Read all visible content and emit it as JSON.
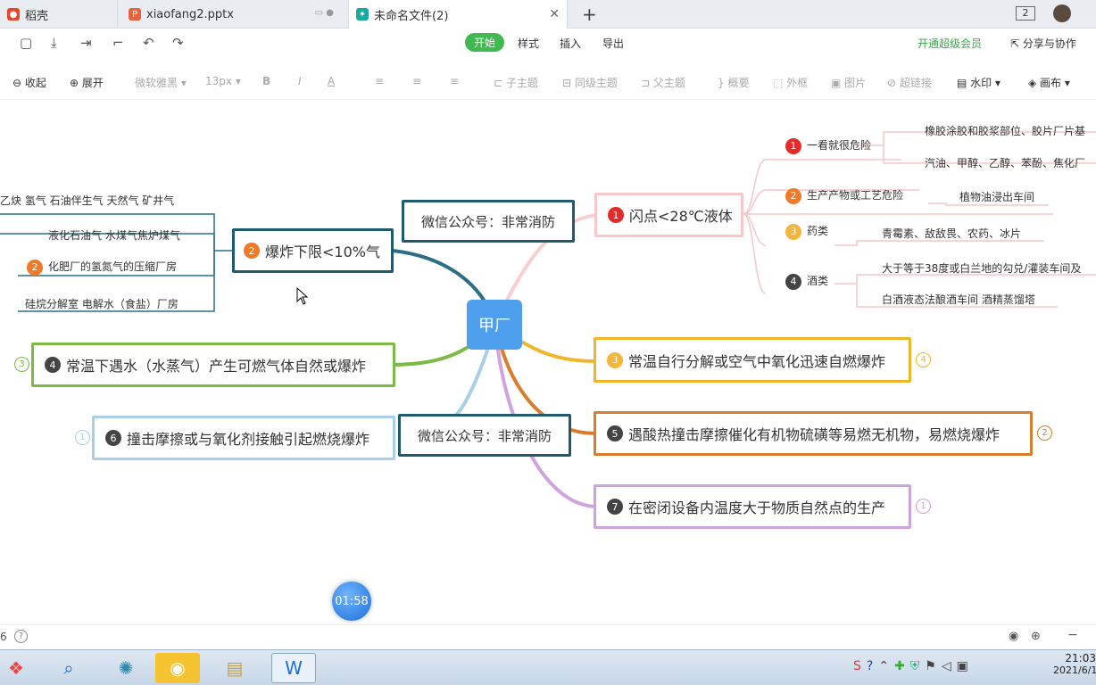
{
  "tabs": [
    {
      "label": "稻壳",
      "icon": "daoke-icon"
    },
    {
      "label": "xiaofang2.pptx",
      "icon": "ppt-icon"
    },
    {
      "label": "未命名文件(2)",
      "icon": "mindmap-icon"
    }
  ],
  "tab_badge": "2",
  "menu": {
    "start": "开始",
    "style": "样式",
    "insert": "插入",
    "export": "导出",
    "vip": "开通超级会员",
    "share": "分享与协作"
  },
  "toolbar2": {
    "collapse": "收起",
    "expand": "展开",
    "font": "微软雅黑",
    "size": "13px",
    "bold": "B",
    "italic": "I",
    "color": "A",
    "child": "子主题",
    "sibling": "同级主题",
    "parent": "父主题",
    "summary": "概要",
    "frame": "外框",
    "image": "图片",
    "link": "超链接",
    "watermark": "水印",
    "canvas": "画布"
  },
  "mindmap": {
    "root": "甲厂",
    "wechat1": "微信公众号：非常消防",
    "wechat2": "微信公众号：非常消防",
    "b1": {
      "num": "1",
      "text": "闪点<28℃液体"
    },
    "b2": {
      "num": "2",
      "text": "爆炸下限<10%气"
    },
    "b3": {
      "num": "3",
      "text": "常温自行分解或空气中氧化迅速自燃爆炸",
      "side": "4"
    },
    "b4": {
      "num": "4",
      "text": "常温下遇水（水蒸气）产生可燃气体自然或爆炸",
      "side": "3"
    },
    "b5": {
      "num": "5",
      "text": "遇酸热撞击摩擦催化有机物硫磺等易燃无机物，易燃烧爆炸",
      "side": "2"
    },
    "b6": {
      "num": "6",
      "text": "撞击摩擦或与氧化剂接触引起燃烧爆炸",
      "side": "1"
    },
    "b7": {
      "num": "7",
      "text": "在密闭设备内温度大于物质自然点的生产",
      "side": "1"
    },
    "b1_children": [
      {
        "num": "1",
        "text": "一看就很危险",
        "leaves": [
          "橡胶涂胶和胶浆部位、胶片厂片基",
          "汽油、甲醇、乙醇、苯酚、焦化厂"
        ]
      },
      {
        "num": "2",
        "text": "生产产物或工艺危险",
        "leaves": [
          "植物油浸出车间"
        ]
      },
      {
        "num": "3",
        "text": "药类",
        "leaves": [
          "青霉素、敌敌畏、农药、冰片"
        ]
      },
      {
        "num": "4",
        "text": "酒类",
        "leaves": [
          "大于等于38度或白兰地的勾兑/灌装车间及",
          "白酒液态法酿酒车间 酒精蒸馏塔"
        ]
      }
    ],
    "b2_children": [
      {
        "text": "乙炔 氢气 石油伴生气 天然气 矿井气"
      },
      {
        "text": "液化石油气 水煤气焦炉煤气"
      },
      {
        "num": "2",
        "text": "化肥厂的氢氮气的压缩厂房"
      },
      {
        "text": "硅烷分解室 电解水（食盐）厂房"
      }
    ]
  },
  "timer": "01:58",
  "status": {
    "page": "6"
  },
  "clock": {
    "time": "21:03",
    "date": "2021/6/1"
  }
}
